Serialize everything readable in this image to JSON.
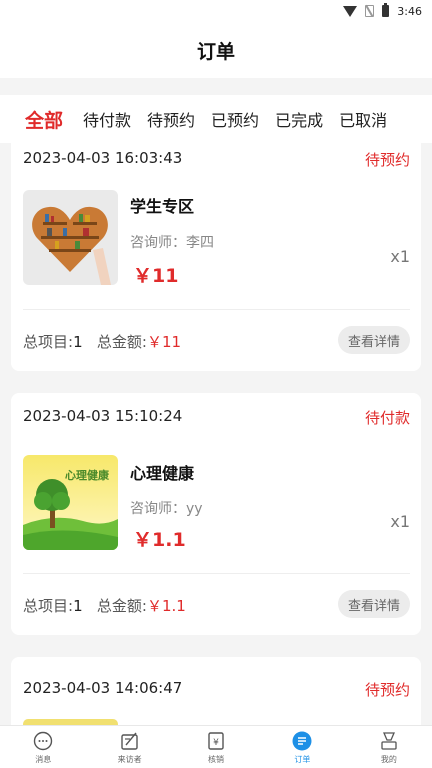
{
  "status_bar": {
    "time": "3:46"
  },
  "header": {
    "title": "订单"
  },
  "tabs": [
    {
      "label": "全部",
      "active": true
    },
    {
      "label": "待付款",
      "active": false
    },
    {
      "label": "待预约",
      "active": false
    },
    {
      "label": "已预约",
      "active": false
    },
    {
      "label": "已完成",
      "active": false
    },
    {
      "label": "已取消",
      "active": false
    }
  ],
  "orders": [
    {
      "time": "2023-04-03 16:03:43",
      "status": "待预约",
      "product": "学生专区",
      "counselor_label": "咨询师：",
      "counselor": "李四",
      "price": "￥11",
      "qty": "x1",
      "items_label": "总项目:",
      "items": "1",
      "total_label": "总金额:",
      "total": "￥11",
      "detail_button": "查看详情"
    },
    {
      "time": "2023-04-03 15:10:24",
      "status": "待付款",
      "product": "心理健康",
      "counselor_label": "咨询师：",
      "counselor": "yy",
      "price": "￥1.1",
      "qty": "x1",
      "items_label": "总项目:",
      "items": "1",
      "total_label": "总金额:",
      "total": "￥1.1",
      "detail_button": "查看详情",
      "thumb_text": "心理健康"
    },
    {
      "time": "2023-04-03 14:06:47",
      "status": "待预约"
    }
  ],
  "bottom_nav": [
    {
      "label": "消息",
      "icon": "message-icon",
      "active": false
    },
    {
      "label": "来访者",
      "icon": "visitor-icon",
      "active": false
    },
    {
      "label": "核销",
      "icon": "verify-icon",
      "active": false
    },
    {
      "label": "订单",
      "icon": "order-icon",
      "active": true
    },
    {
      "label": "我的",
      "icon": "profile-icon",
      "active": false
    }
  ],
  "colors": {
    "accent": "#e02b2b",
    "nav_active": "#1e90e6"
  }
}
